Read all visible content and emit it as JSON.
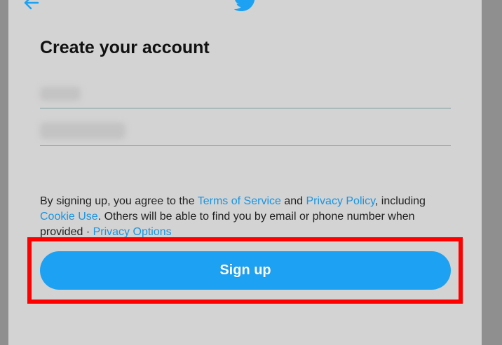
{
  "colors": {
    "accent": "#1da1f2",
    "link": "#1b95e0",
    "highlight_box": "#ff0000",
    "modal_background": "#d3d3d3",
    "overlay": "#8f8f8f"
  },
  "header": {
    "back_icon": "arrow-left-icon",
    "logo_icon": "twitter-bird-icon"
  },
  "title": "Create your account",
  "form": {
    "name_field": {
      "value": "",
      "redacted": true
    },
    "phone_field": {
      "value": "",
      "redacted": true
    }
  },
  "legal": {
    "part1": "By signing up, you agree to the ",
    "terms_link": "Terms of Service",
    "part2": " and ",
    "privacy_link": "Privacy Policy",
    "part3": ", including ",
    "cookie_link": "Cookie Use",
    "part4": ". Others will be able to find you by email or phone number when provided · ",
    "options_link": "Privacy Options"
  },
  "signup_button": "Sign up"
}
